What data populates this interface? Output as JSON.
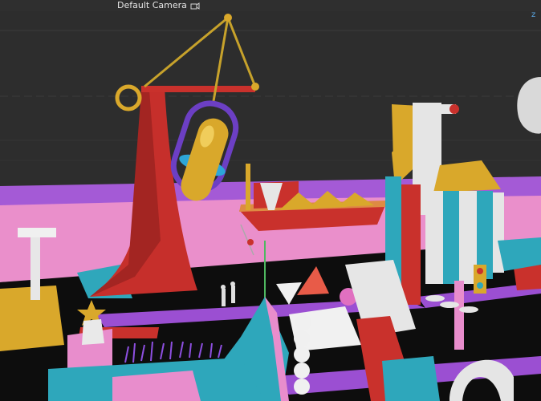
{
  "viewport": {
    "camera_label": "Default Camera",
    "camera_icon": "camera-icon",
    "gizmo_label": "z"
  },
  "colors": {
    "background": "#2b2b2b",
    "grid": "#3a3a3a",
    "floor_pink": "#e98fc9",
    "floor_purple": "#a25bd8",
    "red": "#c9312c",
    "yellow": "#d8a629",
    "teal": "#31a5b9",
    "white": "#e9e9e9",
    "black": "#0c0c0c"
  }
}
